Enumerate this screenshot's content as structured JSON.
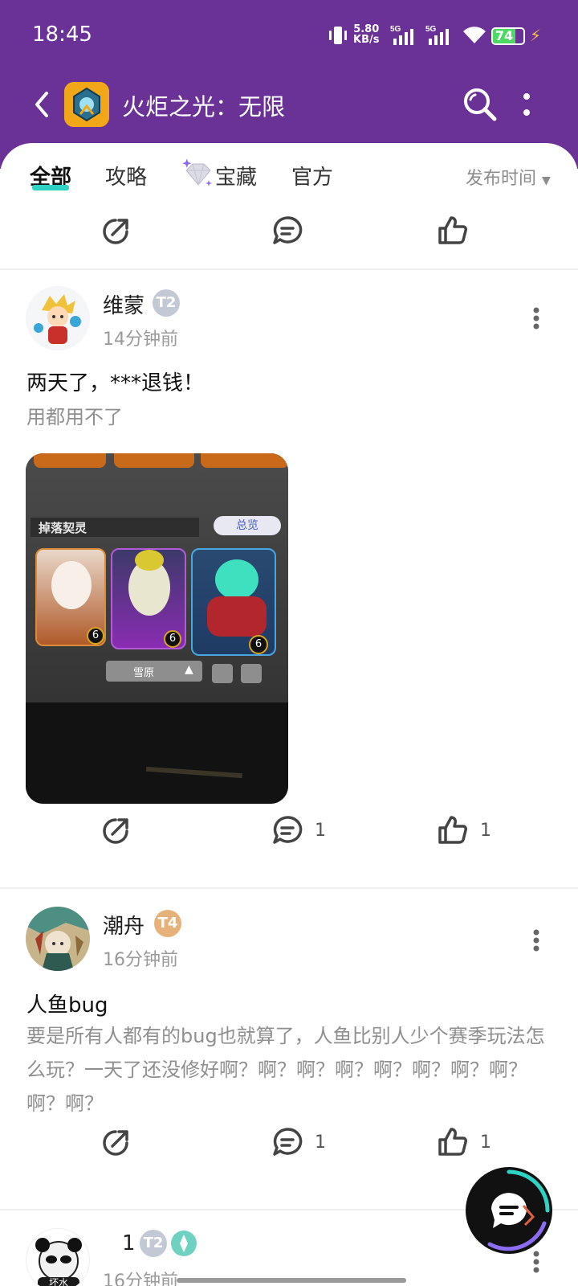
{
  "status_bar": {
    "time": "18:45",
    "net_speed_top": "5.80",
    "net_speed_bottom": "KB/s",
    "net_type_1": "5G",
    "net_type_2": "5G",
    "battery": "74"
  },
  "header": {
    "title": "火炬之光：无限"
  },
  "tabs": {
    "all": "全部",
    "guide": "攻略",
    "treasure": "宝藏",
    "official": "官方",
    "sort": "发布时间"
  },
  "top_actions": {
    "comment_count": "",
    "like_count": ""
  },
  "posts": [
    {
      "username": "维蒙",
      "level": "T2",
      "time": "14分钟前",
      "title": "两天了，***退钱！",
      "body": "用都用不了",
      "image": {
        "section_label": "掉落契灵",
        "overview_button": "总览",
        "card_levels": [
          "6",
          "6",
          "6"
        ],
        "region_label": "雪原"
      },
      "comment_count": "1",
      "like_count": "1"
    },
    {
      "username": "潮舟",
      "level": "T4",
      "time": "16分钟前",
      "title": "人鱼bug",
      "body": "要是所有人都有的bug也就算了，人鱼比别人少个赛季玩法怎么玩？一天了还没修好啊？啊？啊？啊？啊？啊？啊？啊？啊？啊？",
      "comment_count": "1",
      "like_count": "1"
    },
    {
      "username": "1",
      "level": "T2",
      "time": "16分钟前",
      "avatar_text": "坏水"
    }
  ],
  "colors": {
    "header_bg": "#6a3197",
    "tab_accent": "#2fd3c4"
  },
  "icons": [
    "back-icon",
    "search-icon",
    "more-icon",
    "share-icon",
    "comment-icon",
    "like-icon",
    "chat-fab-icon"
  ]
}
